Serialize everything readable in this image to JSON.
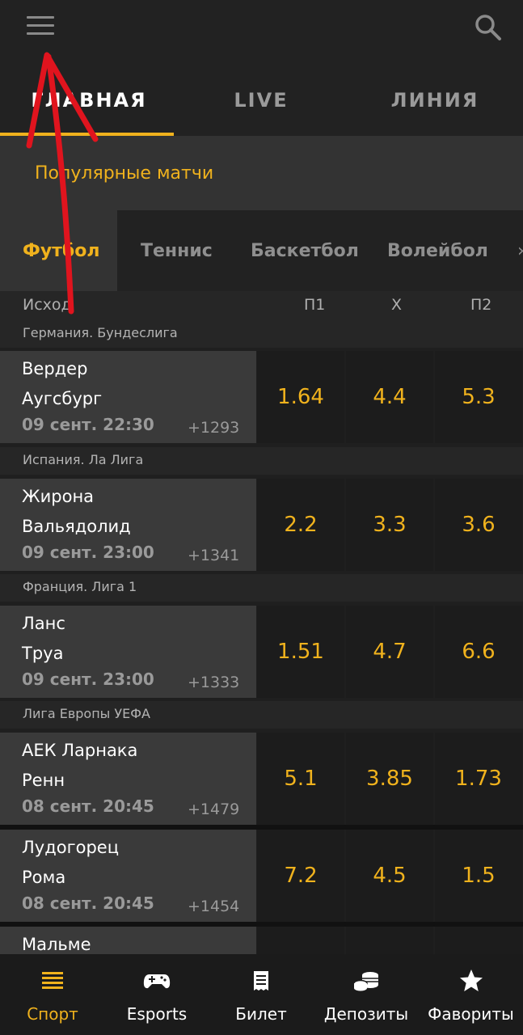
{
  "tabs": [
    {
      "label": "ГЛАВНАЯ",
      "active": true
    },
    {
      "label": "LIVE",
      "active": false
    },
    {
      "label": "ЛИНИЯ",
      "active": false
    }
  ],
  "popular": {
    "title": "Популярные матчи"
  },
  "sports": [
    {
      "label": "Футбол",
      "active": true
    },
    {
      "label": "Теннис",
      "active": false
    },
    {
      "label": "Баскетбол",
      "active": false
    },
    {
      "label": "Волейбол",
      "active": false
    }
  ],
  "columns": {
    "outcome": "Исход",
    "p1": "П1",
    "x": "Х",
    "p2": "П2"
  },
  "leagues": [
    "Германия. Бундеслига",
    "Испания. Ла Лига",
    "Франция. Лига 1",
    "Лига Европы УЕФА"
  ],
  "matches": [
    {
      "team1": "Вердер",
      "team2": "Аугсбург",
      "date": "09 сент. 22:30",
      "more": "+1293",
      "p1": "1.64",
      "x": "4.4",
      "p2": "5.3"
    },
    {
      "team1": "Жирона",
      "team2": "Вальядолид",
      "date": "09 сент. 23:00",
      "more": "+1341",
      "p1": "2.2",
      "x": "3.3",
      "p2": "3.6"
    },
    {
      "team1": "Ланс",
      "team2": "Труа",
      "date": "09 сент. 23:00",
      "more": "+1333",
      "p1": "1.51",
      "x": "4.7",
      "p2": "6.6"
    },
    {
      "team1": "АЕК Ларнака",
      "team2": "Ренн",
      "date": "08 сент. 20:45",
      "more": "+1479",
      "p1": "5.1",
      "x": "3.85",
      "p2": "1.73"
    },
    {
      "team1": "Лудогорец",
      "team2": "Рома",
      "date": "08 сент. 20:45",
      "more": "+1454",
      "p1": "7.2",
      "x": "4.5",
      "p2": "1.5"
    },
    {
      "team1": "Мальме"
    }
  ],
  "bottom_nav": [
    {
      "label": "Спорт",
      "icon": "list-icon",
      "active": true
    },
    {
      "label": "Esports",
      "icon": "gamepad-icon",
      "active": false
    },
    {
      "label": "Билет",
      "icon": "ticket-icon",
      "active": false
    },
    {
      "label": "Депозиты",
      "icon": "coins-icon",
      "active": false
    },
    {
      "label": "Фавориты",
      "icon": "star-icon",
      "active": false
    }
  ],
  "colors": {
    "accent": "#f0b21d",
    "annotation_arrow": "#e0141e",
    "background": "#1f1f1f"
  }
}
